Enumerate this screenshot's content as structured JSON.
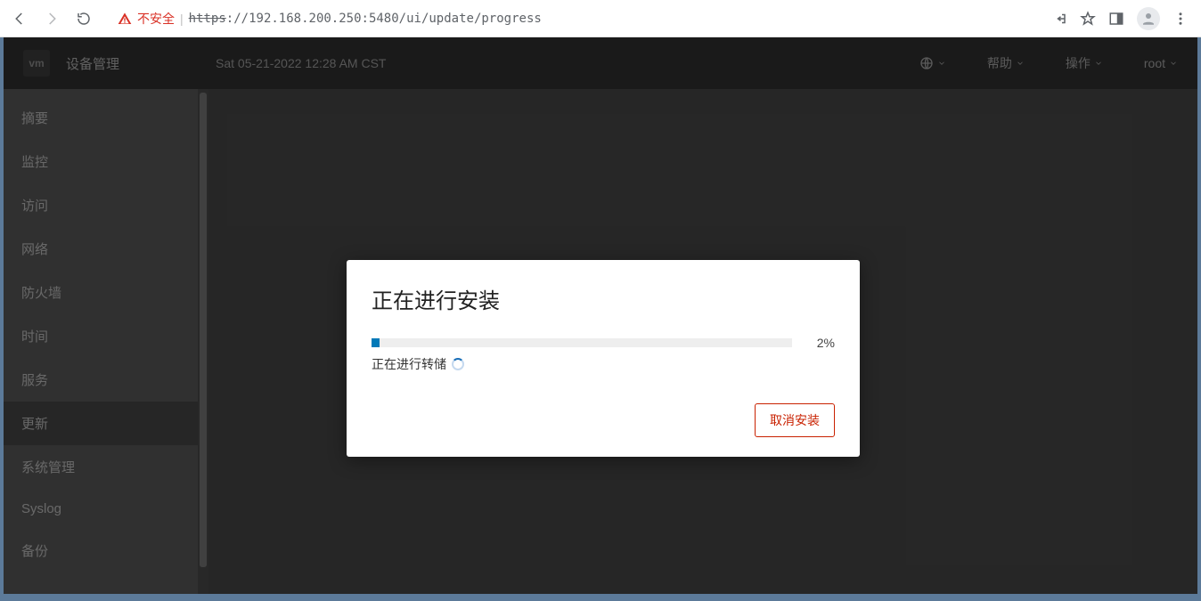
{
  "browser": {
    "not_secure": "不安全",
    "url_scheme": "https",
    "url_rest": "://192.168.200.250:5480/ui/update/progress"
  },
  "header": {
    "app_title": "设备管理",
    "timestamp": "Sat 05-21-2022 12:28 AM CST",
    "help": "帮助",
    "actions": "操作",
    "user": "root"
  },
  "sidebar": {
    "items": [
      {
        "label": "摘要"
      },
      {
        "label": "监控"
      },
      {
        "label": "访问"
      },
      {
        "label": "网络"
      },
      {
        "label": "防火墙"
      },
      {
        "label": "时间"
      },
      {
        "label": "服务"
      },
      {
        "label": "更新"
      },
      {
        "label": "系统管理"
      },
      {
        "label": "Syslog"
      },
      {
        "label": "备份"
      }
    ],
    "active_index": 7
  },
  "modal": {
    "title": "正在进行安装",
    "status": "正在进行转储",
    "percent_label": "2%",
    "percent_value": 2,
    "cancel": "取消安装"
  }
}
